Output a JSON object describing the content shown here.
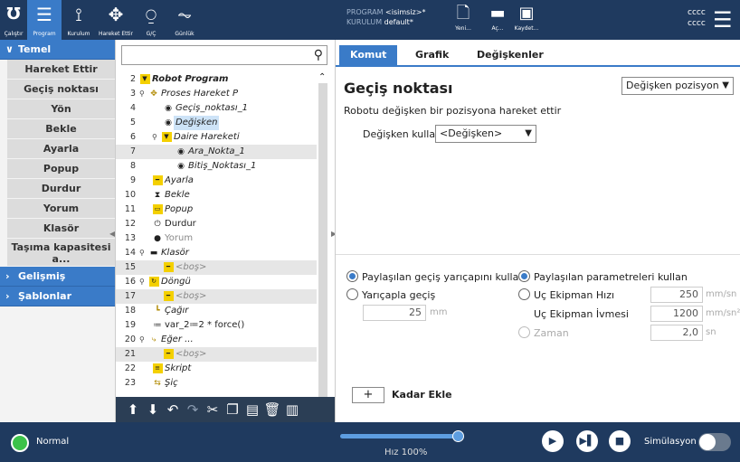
{
  "topbar": {
    "nav": [
      {
        "label": "Çalıştır",
        "icon": "ur-logo-icon"
      },
      {
        "label": "Program",
        "icon": "program-icon"
      },
      {
        "label": "Kurulum",
        "icon": "installation-icon"
      },
      {
        "label": "Hareket Ettir",
        "icon": "move-icon"
      },
      {
        "label": "G/Ç",
        "icon": "io-icon"
      },
      {
        "label": "Günlük",
        "icon": "log-icon"
      }
    ],
    "program_key": "PROGRAM",
    "program_value": "<isimsiz>*",
    "installation_key": "KURULUM",
    "installation_value": "default*",
    "file_buttons": [
      {
        "label": "Yeni...",
        "icon": "new-file-icon"
      },
      {
        "label": "Aç...",
        "icon": "folder-icon"
      },
      {
        "label": "Kaydet...",
        "icon": "save-icon"
      }
    ],
    "user_line1": "cccc",
    "user_line2": "cccc"
  },
  "sidebar": {
    "basic_label": "Temel",
    "items": [
      "Hareket Ettir",
      "Geçiş noktası",
      "Yön",
      "Bekle",
      "Ayarla",
      "Popup",
      "Durdur",
      "Yorum",
      "Klasör",
      "Taşıma kapasitesi a..."
    ],
    "advanced_label": "Gelişmiş",
    "templates_label": "Şablonlar"
  },
  "tree": {
    "rows": [
      {
        "num": "2",
        "label": "Robot Program"
      },
      {
        "num": "3",
        "label": "Proses Hareket P"
      },
      {
        "num": "4",
        "label": "Geçiş_noktası_1"
      },
      {
        "num": "5",
        "label": "Değişken"
      },
      {
        "num": "6",
        "label": "Daire Hareketi"
      },
      {
        "num": "7",
        "label": "Ara_Nokta_1"
      },
      {
        "num": "8",
        "label": "Bitiş_Noktası_1"
      },
      {
        "num": "9",
        "label": "Ayarla"
      },
      {
        "num": "10",
        "label": "Bekle"
      },
      {
        "num": "11",
        "label": "Popup"
      },
      {
        "num": "12",
        "label": "Durdur"
      },
      {
        "num": "13",
        "label": "Yorum"
      },
      {
        "num": "14",
        "label": "Klasör"
      },
      {
        "num": "15",
        "label": "<boş>"
      },
      {
        "num": "16",
        "label": "Döngü"
      },
      {
        "num": "17",
        "label": "<boş>"
      },
      {
        "num": "18",
        "label": "Çağır"
      },
      {
        "num": "19",
        "label": "var_2≔2 * force()"
      },
      {
        "num": "20",
        "label": "Eğer ..."
      },
      {
        "num": "21",
        "label": "<boş>"
      },
      {
        "num": "22",
        "label": "Skript"
      },
      {
        "num": "23",
        "label": "Şiç"
      }
    ]
  },
  "content": {
    "tabs": [
      "Komut",
      "Grafik",
      "Değişkenler"
    ],
    "title": "Geçiş noktası",
    "waypoint_type": "Değişken pozisyon",
    "description": "Robotu değişken bir pozisyona hareket ettir",
    "use_variable_label": "Değişken kullan",
    "use_variable_value": "<Değişken>",
    "shared_blend_label": "Paylaşılan geçiş yarıçapını kullan",
    "blend_radius_label": "Yarıçapla geçiş",
    "blend_value": "25",
    "blend_unit": "mm",
    "shared_params_label": "Paylaşılan parametreleri kullan",
    "tool_speed_label": "Uç Ekipman Hızı",
    "tool_speed_value": "250",
    "tool_speed_unit": "mm/sn",
    "tool_accel_label": "Uç Ekipman İvmesi",
    "tool_accel_value": "1200",
    "tool_accel_unit": "mm/sn²",
    "time_label": "Zaman",
    "time_value": "2,0",
    "time_unit": "sn",
    "add_until_label": "Kadar Ekle"
  },
  "bottombar": {
    "status": "Normal",
    "speed": "Hız 100%",
    "simulation": "Simülasyon"
  }
}
